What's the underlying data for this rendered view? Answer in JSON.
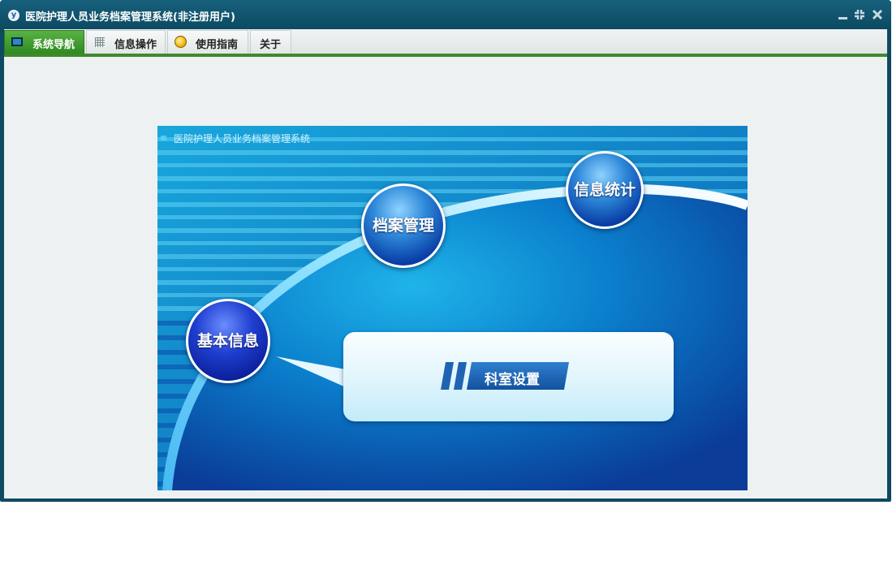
{
  "window": {
    "title": "医院护理人员业务档案管理系统(非注册用户)",
    "app_icon_glyph": "y",
    "controls": [
      "minimize-icon",
      "restore-icon",
      "close-icon"
    ]
  },
  "toolbar": {
    "tabs": [
      {
        "label": "系统导航",
        "icon": "monitor-icon",
        "active": true
      },
      {
        "label": "信息操作",
        "icon": "grid-icon",
        "active": false
      },
      {
        "label": "使用指南",
        "icon": "guide-icon",
        "active": false
      },
      {
        "label": "关于",
        "icon": "",
        "active": false
      }
    ]
  },
  "banner": {
    "title": "医院护理人员业务档案管理系统",
    "nodes": [
      {
        "label": "基本信息"
      },
      {
        "label": "档案管理"
      },
      {
        "label": "信息统计"
      }
    ],
    "callout": {
      "button_label": "科室设置"
    }
  },
  "colors": {
    "titlebar": "#0e4a61",
    "active_tab": "#3f8a2c",
    "banner_blue": "#0a6fc0"
  }
}
